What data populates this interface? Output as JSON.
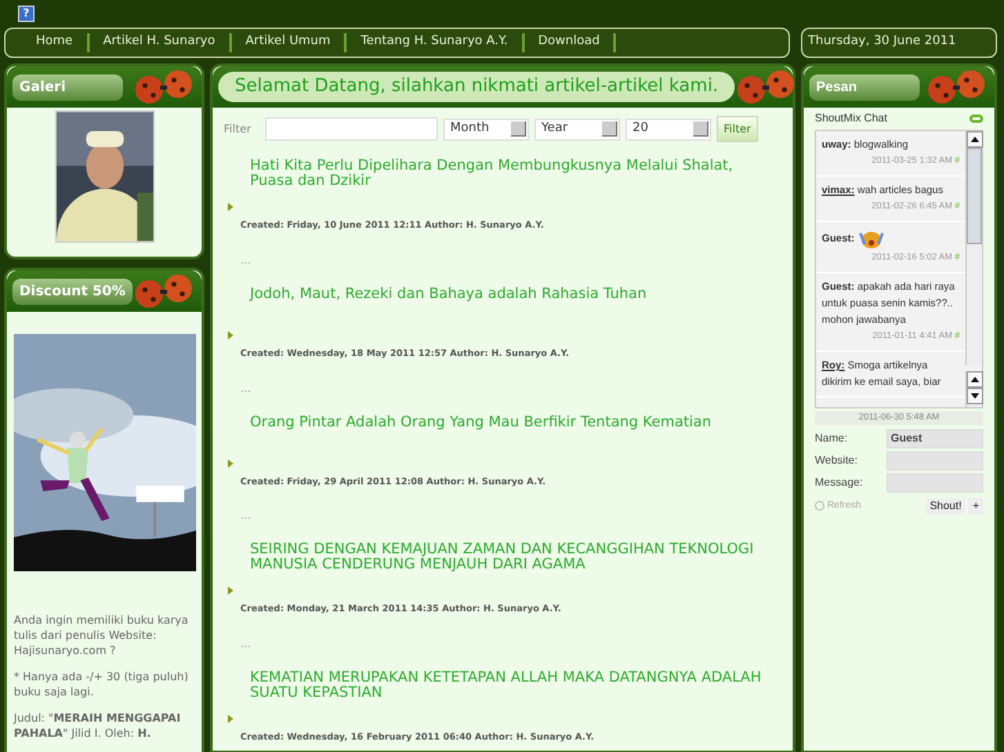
{
  "help": "?",
  "nav": {
    "items": [
      {
        "label": "Home"
      },
      {
        "label": "Artikel H. Sunaryo"
      },
      {
        "label": "Artikel Umum"
      },
      {
        "label": "Tentang H. Sunaryo A.Y."
      },
      {
        "label": "Download"
      }
    ],
    "date": "Thursday, 30 June 2011"
  },
  "left": {
    "gallery": {
      "title": "Galeri"
    },
    "discount": {
      "title": "Discount 50%",
      "paragraphs": [
        "Anda ingin memiliki buku karya tulis dari penulis Website: Hajisunaryo.com ?",
        "* Hanya ada -/+ 30 (tiga puluh) buku saja lagi.",
        "Judul: \"**MERAIH MENGGAPAI PAHALA**\" Jilid I. Oleh: **H.**"
      ]
    }
  },
  "main": {
    "title": "Selamat Datang, silahkan nikmati artikel-artikel kami.",
    "filter": {
      "label": "Filter",
      "month": "Month",
      "year": "Year",
      "count": "20",
      "button": "Filter"
    },
    "articles": [
      {
        "title": "Hati Kita Perlu Dipelihara Dengan Membungkusnya Melalui Shalat, Puasa dan Dzikir",
        "meta": "Created: Friday, 10 June 2011 12:11 Author: H. Sunaryo A.Y.",
        "more": "..."
      },
      {
        "title": "Jodoh, Maut, Rezeki dan Bahaya adalah Rahasia Tuhan",
        "meta": "Created: Wednesday, 18 May 2011 12:57 Author: H. Sunaryo A.Y.",
        "more": "..."
      },
      {
        "title": "Orang Pintar Adalah Orang Yang Mau Berfikir Tentang Kematian",
        "meta": "Created: Friday, 29 April 2011 12:08 Author: H. Sunaryo A.Y.",
        "more": "..."
      },
      {
        "title": "SEIRING DENGAN KEMAJUAN ZAMAN DAN KECANGGIHAN TEKNOLOGI MANUSIA CENDERUNG MENJAUH DARI AGAMA",
        "meta": "Created: Monday, 21 March 2011 14:35 Author: H. Sunaryo A.Y.",
        "more": "..."
      },
      {
        "title": "KEMATIAN MERUPAKAN KETETAPAN ALLAH MAKA DATANGNYA ADALAH SUATU KEPASTIAN",
        "meta": "Created: Wednesday, 16 February 2011 06:40 Author: H. Sunaryo A.Y."
      }
    ]
  },
  "right": {
    "title": "Pesan",
    "chat": {
      "title": "ShoutMix Chat",
      "messages": [
        {
          "name": "uway:",
          "text": "blogwalking",
          "time": "2011-03-25 1:32 AM",
          "mark": "#",
          "underline": false
        },
        {
          "name": "vimax:",
          "text": "wah articles bagus",
          "time": "2011-02-26 6:45 AM",
          "mark": "#",
          "underline": true
        },
        {
          "name": "Guest:",
          "kind": "emoticon",
          "time": "2011-02-16 5:02 AM",
          "mark": "#",
          "underline": false
        },
        {
          "name": "Guest:",
          "text": "apakah ada hari raya untuk puasa senin kamis??.. mohon jawabanya",
          "time": "2011-01-11 4:41 AM",
          "mark": "#",
          "underline": false
        },
        {
          "name": "Roy:",
          "text": "Smoga artikelnya dikirim ke email saya, biar",
          "underline": true
        }
      ],
      "footer_time": "2011-06-30 5:48 AM",
      "name_label": "Name:",
      "name_value": "Guest",
      "website_label": "Website:",
      "message_label": "Message:",
      "refresh": "Refresh",
      "shout": "Shout!",
      "plus": "+"
    }
  }
}
